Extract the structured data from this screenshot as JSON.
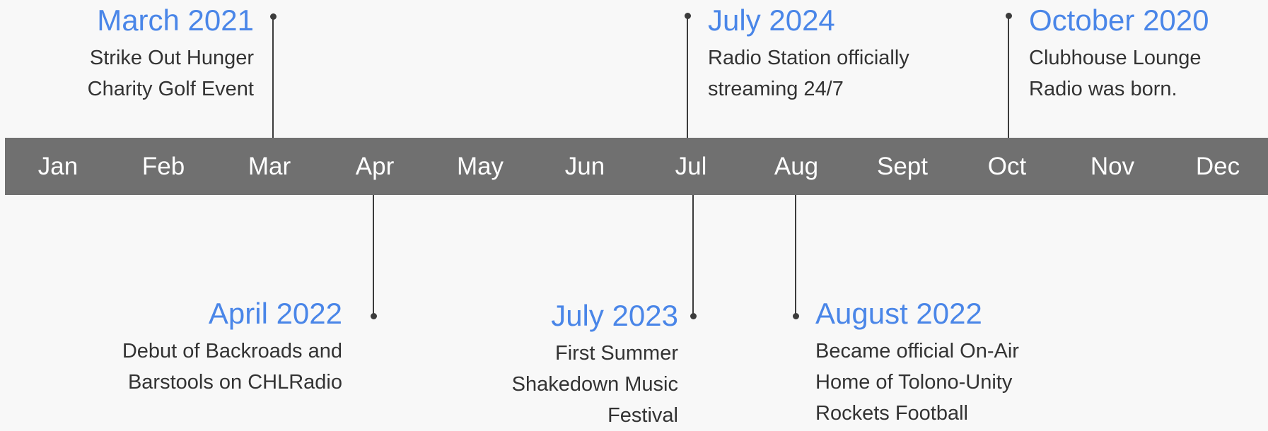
{
  "months": [
    "Jan",
    "Feb",
    "Mar",
    "Apr",
    "May",
    "Jun",
    "Jul",
    "Aug",
    "Sept",
    "Oct",
    "Nov",
    "Dec"
  ],
  "events_above": [
    {
      "date": "March 2021",
      "description": "Strike Out Hunger Charity Golf Event"
    },
    {
      "date": "July 2024",
      "description": "Radio Station  officially streaming 24/7"
    },
    {
      "date": "October 2020",
      "description": "Clubhouse Lounge Radio was born."
    }
  ],
  "events_below": [
    {
      "date": "April 2022",
      "description": "Debut of Backroads and Barstools on CHLRadio"
    },
    {
      "date": "July 2023",
      "description": "First Summer Shakedown Music Festival"
    },
    {
      "date": "August 2022",
      "description": "Became official On-Air Home of Tolono-Unity Rockets Football"
    }
  ],
  "colors": {
    "band": "#707070",
    "date": "#4a86e8",
    "text": "#333333",
    "connector": "#3c3c3c"
  }
}
